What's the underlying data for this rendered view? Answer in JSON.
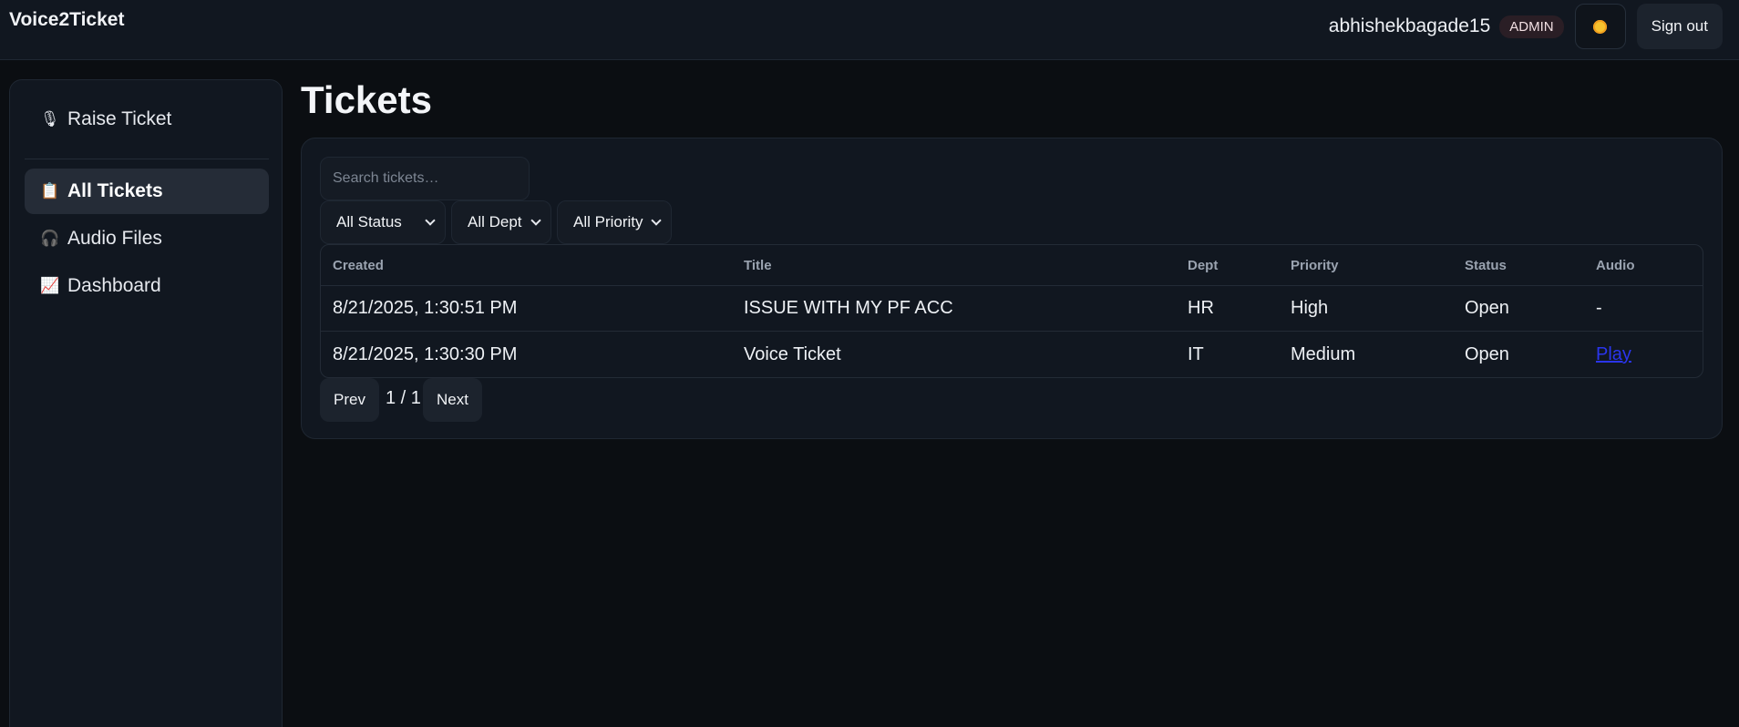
{
  "app": {
    "title": "Voice2Ticket"
  },
  "header": {
    "username": "abhishekbagade15",
    "role": "ADMIN",
    "theme_icon": "sun-icon",
    "signout_label": "Sign out"
  },
  "sidebar": {
    "items": [
      {
        "icon": "microphone-icon",
        "glyph": "🎙",
        "label": "Raise Ticket",
        "active": false
      },
      {
        "icon": "clipboard-icon",
        "glyph": "📋",
        "label": "All Tickets",
        "active": true
      },
      {
        "icon": "headphones-icon",
        "glyph": "🎧",
        "label": "Audio Files",
        "active": false
      },
      {
        "icon": "chart-increasing-icon",
        "glyph": "📈",
        "label": "Dashboard",
        "active": false
      }
    ]
  },
  "main": {
    "title": "Tickets",
    "search": {
      "placeholder": "Search tickets…",
      "value": ""
    },
    "filters": {
      "status": "All Status",
      "dept": "All Dept",
      "priority": "All Priority"
    },
    "table": {
      "columns": [
        "Created",
        "Title",
        "Dept",
        "Priority",
        "Status",
        "Audio"
      ],
      "rows": [
        {
          "created": "8/21/2025, 1:30:51 PM",
          "title": "ISSUE WITH MY PF ACC",
          "dept": "HR",
          "priority": "High",
          "status": "Open",
          "audio": "-"
        },
        {
          "created": "8/21/2025, 1:30:30 PM",
          "title": "Voice Ticket",
          "dept": "IT",
          "priority": "Medium",
          "status": "Open",
          "audio": "Play"
        }
      ]
    },
    "pagination": {
      "prev_label": "Prev",
      "page_text": "1 / 1",
      "next_label": "Next"
    }
  },
  "colors": {
    "background": "#0b0e12",
    "panel": "#111720",
    "accent_link": "#2a35ee",
    "sun": "#f6c22e"
  }
}
